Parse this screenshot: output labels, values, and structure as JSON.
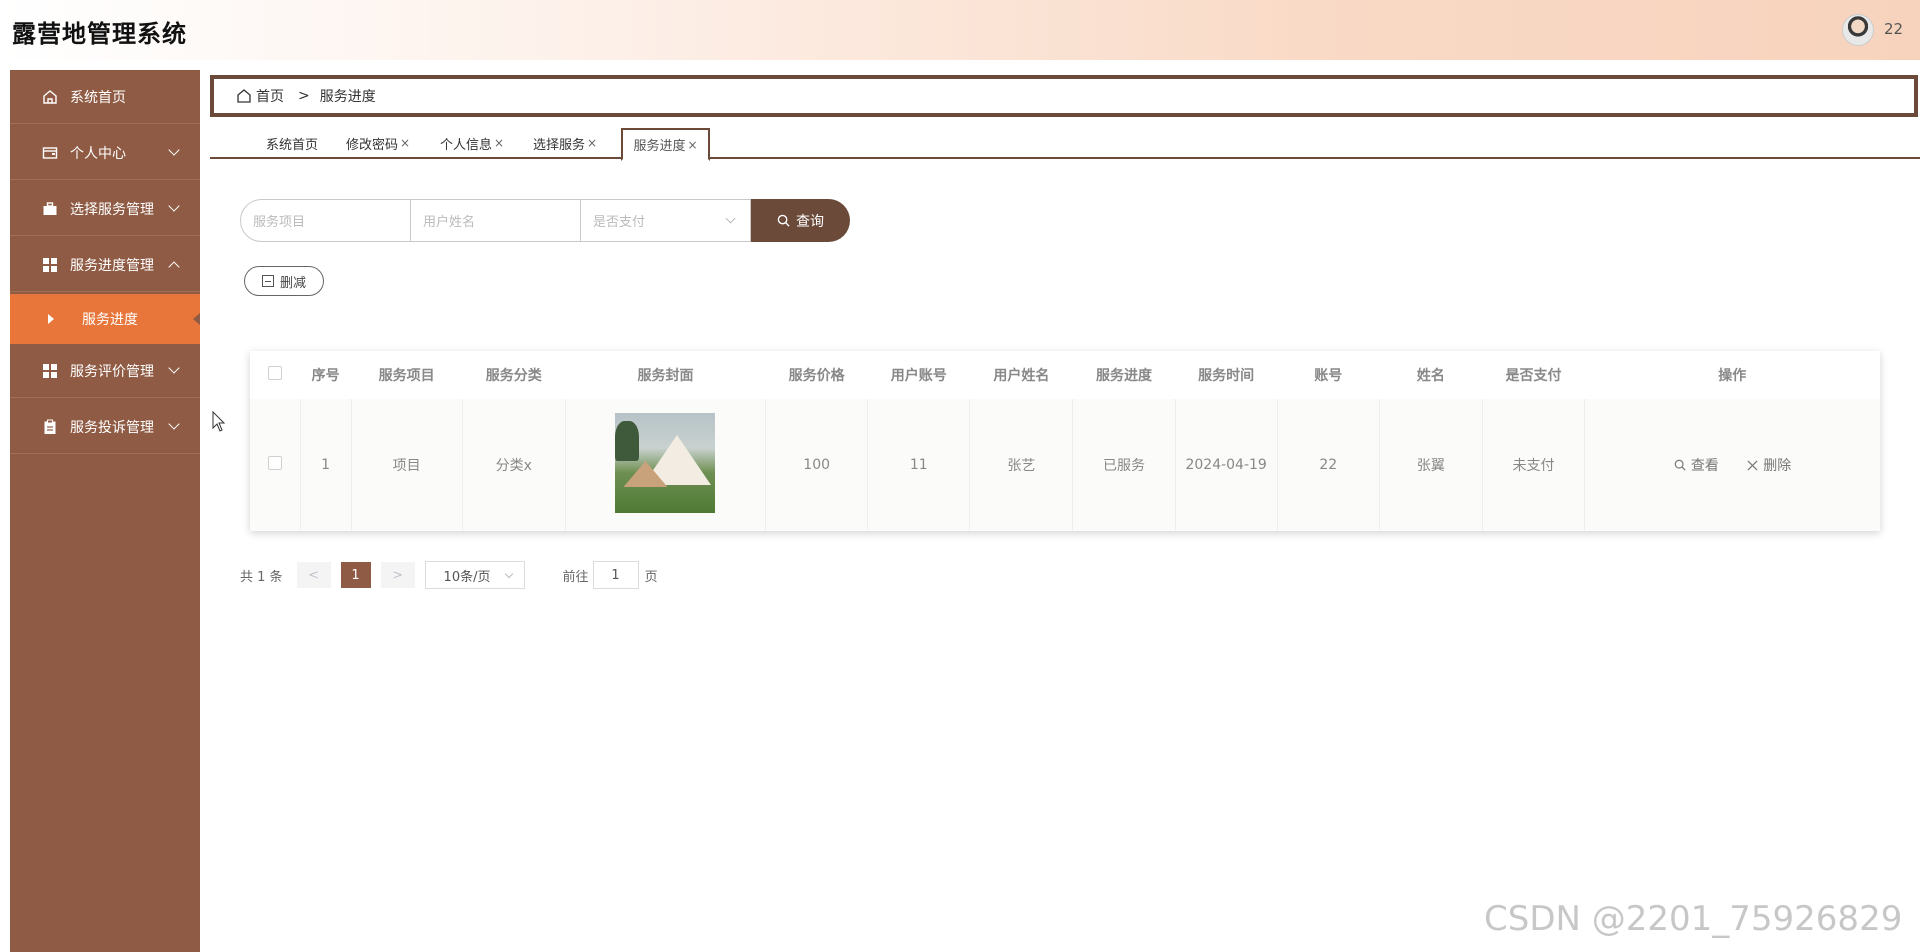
{
  "header": {
    "title": "露营地管理系统",
    "username": "22"
  },
  "sidebar": {
    "items": [
      {
        "label": "系统首页",
        "icon": "home-icon"
      },
      {
        "label": "个人中心",
        "icon": "wallet-icon"
      },
      {
        "label": "选择服务管理",
        "icon": "briefcase-icon"
      },
      {
        "label": "服务进度管理",
        "icon": "grid-icon"
      },
      {
        "label": "服务评价管理",
        "icon": "grid-icon"
      },
      {
        "label": "服务投诉管理",
        "icon": "clipboard-icon"
      }
    ],
    "active_sub": "服务进度"
  },
  "breadcrumb": {
    "home": "首页",
    "sep": ">",
    "current": "服务进度"
  },
  "tabs": [
    {
      "label": "系统首页",
      "closable": false
    },
    {
      "label": "修改密码",
      "closable": true
    },
    {
      "label": "个人信息",
      "closable": true
    },
    {
      "label": "选择服务",
      "closable": true
    },
    {
      "label": "服务进度",
      "closable": true,
      "active": true
    }
  ],
  "tab_close": "×",
  "search": {
    "item_placeholder": "服务项目",
    "name_placeholder": "用户姓名",
    "pay_placeholder": "是否支付",
    "query_label": "查询"
  },
  "delete_label": "删减",
  "table": {
    "columns": [
      "序号",
      "服务项目",
      "服务分类",
      "服务封面",
      "服务价格",
      "用户账号",
      "用户姓名",
      "服务进度",
      "服务时间",
      "账号",
      "姓名",
      "是否支付",
      "操作"
    ],
    "rows": [
      {
        "index": "1",
        "item": "项目",
        "category": "分类x",
        "price": "100",
        "account": "11",
        "user_name": "张艺",
        "progress": "已服务",
        "time": "2024-04-19",
        "acct": "22",
        "name": "张翼",
        "paid": "未支付",
        "view": "查看",
        "delete": "删除"
      }
    ]
  },
  "pagination": {
    "total": "共 1 条",
    "prev": "<",
    "current": "1",
    "next": ">",
    "page_size": "10条/页",
    "goto_label": "前往",
    "goto_value": "1",
    "page_suffix": "页"
  },
  "watermark": "CSDN @2201_75926829",
  "colors": {
    "sidebar": "#8f5b44",
    "active": "#e8763a",
    "primary": "#6b4a3a"
  }
}
